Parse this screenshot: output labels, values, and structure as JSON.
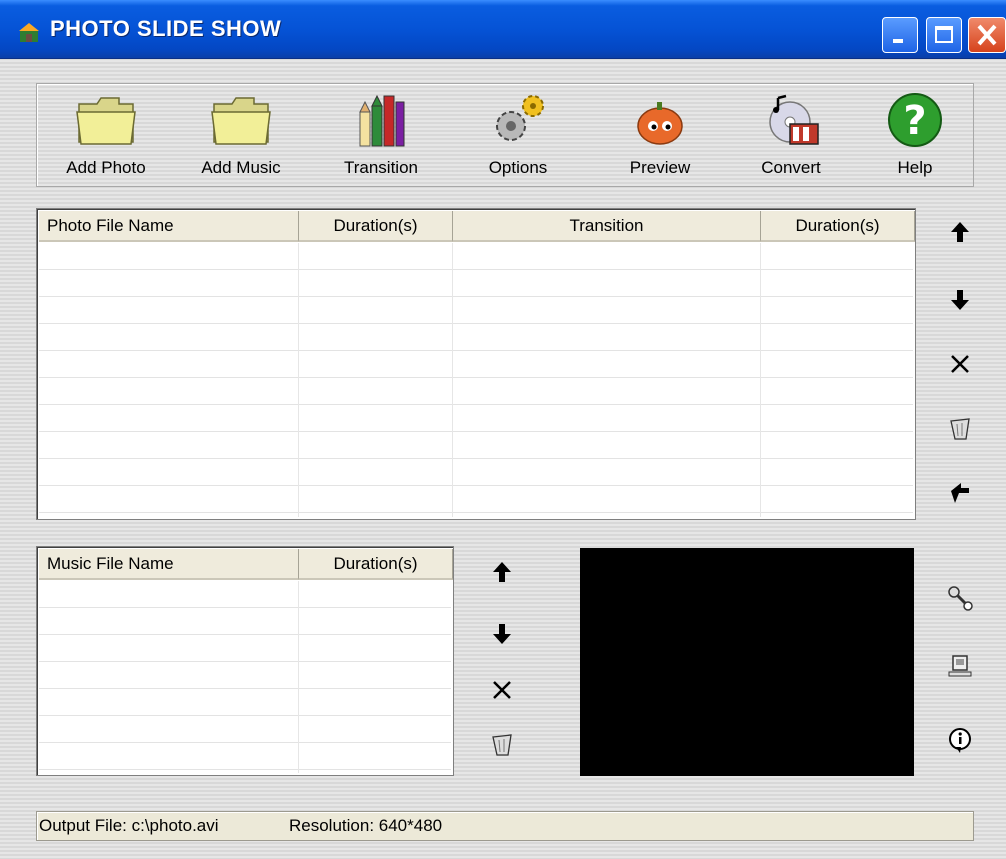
{
  "window": {
    "title": "PHOTO SLIDE SHOW"
  },
  "toolbar": {
    "buttons": [
      {
        "label": "Add Photo",
        "icon": "folder-icon"
      },
      {
        "label": "Add Music",
        "icon": "folder-icon"
      },
      {
        "label": "Transition",
        "icon": "pencils-icon"
      },
      {
        "label": "Options",
        "icon": "gears-icon"
      },
      {
        "label": "Preview",
        "icon": "pumpkin-icon"
      },
      {
        "label": "Convert",
        "icon": "film-cd-icon"
      },
      {
        "label": "Help",
        "icon": "help-icon"
      }
    ]
  },
  "photo_list": {
    "columns": [
      "Photo File Name",
      "Duration(s)",
      "Transition",
      "Duration(s)"
    ],
    "rows": []
  },
  "music_list": {
    "columns": [
      "Music File Name",
      "Duration(s)"
    ],
    "rows": []
  },
  "status": {
    "output_file": "Output File: c:\\photo.avi",
    "resolution": "Resolution: 640*480"
  },
  "colors": {
    "titlebar": "#0553d6",
    "preview_bg": "#000000",
    "close_button": "#d6431c"
  }
}
